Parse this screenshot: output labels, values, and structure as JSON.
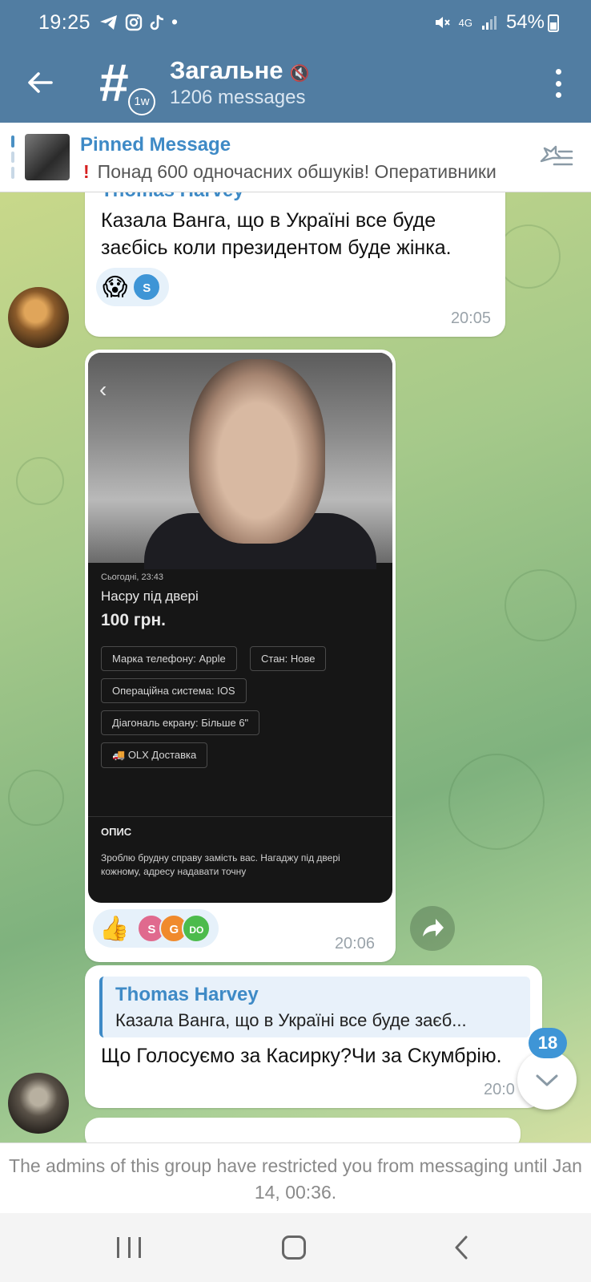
{
  "status_bar": {
    "time": "19:25",
    "app_icons": [
      "telegram-icon",
      "instagram-icon",
      "tiktok-icon",
      "•"
    ],
    "network": "4G",
    "battery": "54%"
  },
  "header": {
    "title": "Загальне",
    "subtitle": "1206 messages",
    "avatar_badge": "1w"
  },
  "pinned": {
    "title": "Pinned Message",
    "text": "Понад 600 одночасних обшуків! Оперативники"
  },
  "messages": [
    {
      "sender": "Thomas Harvey",
      "text": "Казала Ванга, що в Україні все буде заєбісь коли президентом буде жінка.",
      "reaction_emoji": "😱",
      "reactors": [
        "S"
      ],
      "time": "20:05"
    },
    {
      "photo": {
        "date": "Сьогодні, 23:43",
        "title": "Насру під двері",
        "price": "100 грн.",
        "chips": [
          "Марка телефону: Apple",
          "Стан: Нове",
          "Операційна система: IOS",
          "Діагональ екрану: Більше 6\"",
          "OLX Доставка"
        ],
        "desc_heading": "ОПИС",
        "desc": "Зроблю брудну справу замість вас. Нагаджу під двері кожному, адресу надавати точну"
      },
      "reaction_emoji": "👍",
      "reactors": [
        "S",
        "G",
        "DO"
      ],
      "time": "20:06"
    },
    {
      "reply_name": "Thomas Harvey",
      "reply_text": "Казала Ванга, що в Україні все буде заєб...",
      "text": "Що Голосуємо за Касирку?Чи за Скумбрію.",
      "time": "20:0"
    }
  ],
  "unread_count": "18",
  "restriction_text": "The admins of this group have restricted you from messaging until Jan 14, 00:36.",
  "colors": {
    "header": "#517da2",
    "accent": "#3e8ac6",
    "reaction_bg": "#e6f1fa",
    "reactor_s1": "#3e95d6",
    "reactor_s2": "#e06a8e",
    "reactor_g": "#f08a2c",
    "reactor_do": "#4cbb4c"
  }
}
